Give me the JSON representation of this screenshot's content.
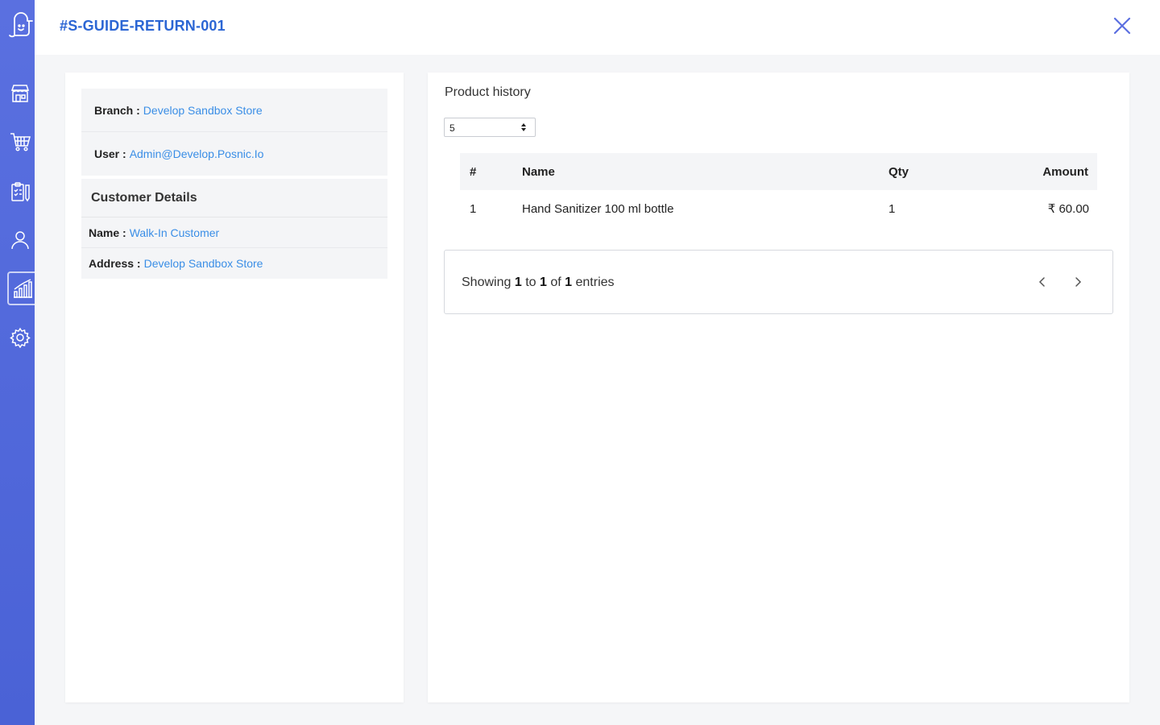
{
  "header": {
    "title": "#S-GUIDE-RETURN-001"
  },
  "sidebar": {
    "items": [
      {
        "name": "store-icon"
      },
      {
        "name": "cart-icon"
      },
      {
        "name": "clipboard-icon"
      },
      {
        "name": "user-icon"
      },
      {
        "name": "chart-icon",
        "active": true
      },
      {
        "name": "gear-icon"
      }
    ]
  },
  "info": {
    "branch_label": "Branch :",
    "branch_value": "Develop Sandbox Store",
    "user_label": "User :",
    "user_value": "Admin@Develop.Posnic.Io"
  },
  "customer": {
    "heading": "Customer Details",
    "name_label": "Name :",
    "name_value": "Walk-In Customer",
    "address_label": "Address :",
    "address_value": "Develop Sandbox Store"
  },
  "product_history": {
    "title": "Product history",
    "page_size": "5",
    "columns": {
      "num": "#",
      "name": "Name",
      "qty": "Qty",
      "amount": "Amount"
    },
    "rows": [
      {
        "num": "1",
        "name": "Hand Sanitizer 100 ml bottle",
        "qty": "1",
        "amount": "₹ 60.00"
      }
    ],
    "pagination": {
      "showing": "Showing",
      "from": "1",
      "to_word": "to",
      "to": "1",
      "of_word": "of",
      "total": "1",
      "entries": "entries"
    }
  },
  "colors": {
    "sidebar": "#4a62d6",
    "title": "#2c66d4",
    "link": "#3a8ee6",
    "close": "#5b6fe0"
  }
}
